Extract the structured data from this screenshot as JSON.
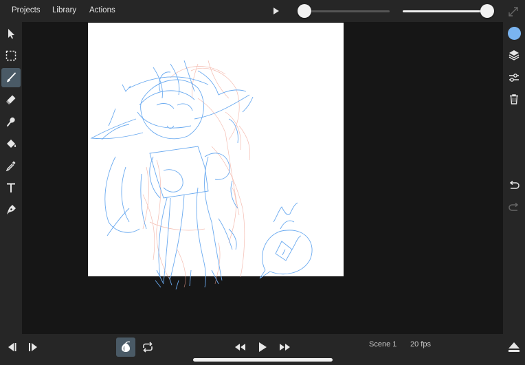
{
  "menu": {
    "projects": "Projects",
    "library": "Library",
    "actions": "Actions"
  },
  "sliders": {
    "brush_size_percent": 0,
    "opacity_percent": 100
  },
  "colors": {
    "current_color": "#7ab4f0",
    "active_layer_stroke": "#6aaaf0",
    "onion_skin_stroke": "#f0a090"
  },
  "left_toolbar": [
    "select-arrow",
    "marquee",
    "brush",
    "eraser",
    "smudge",
    "fill-bucket",
    "eyedropper",
    "text",
    "pen"
  ],
  "active_tool": "brush",
  "right_toolbar": [
    "color-picker",
    "layers",
    "adjustments",
    "delete",
    "undo",
    "redo"
  ],
  "bottom": {
    "scene": "Scene 1",
    "fps": "20 fps",
    "onion_skin": "on",
    "loop": "on"
  }
}
